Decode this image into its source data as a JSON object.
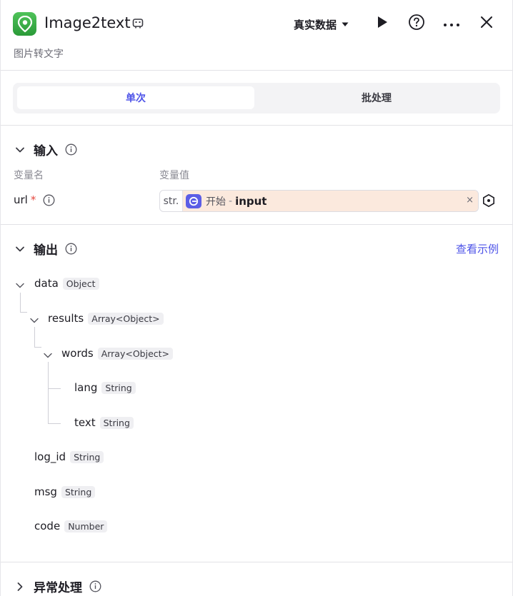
{
  "header": {
    "title": "Image2text",
    "subtitle": "图片转文字",
    "data_mode": "真实数据"
  },
  "tabs": [
    {
      "label": "单次",
      "active": true
    },
    {
      "label": "批处理",
      "active": false
    }
  ],
  "input_section": {
    "title": "输入",
    "col_name": "变量名",
    "col_value": "变量值",
    "param": {
      "name": "url",
      "required_mark": "*",
      "type_tag": "str.",
      "ref_node": "开始",
      "ref_sep": "-",
      "ref_var": "input",
      "clear": "×"
    }
  },
  "output_section": {
    "title": "输出",
    "example_link": "查看示例",
    "fields": [
      {
        "name": "data",
        "type": "Object"
      },
      {
        "name": "results",
        "type": "Array<Object>"
      },
      {
        "name": "words",
        "type": "Array<Object>"
      },
      {
        "name": "lang",
        "type": "String"
      },
      {
        "name": "text",
        "type": "String"
      },
      {
        "name": "log_id",
        "type": "String"
      },
      {
        "name": "msg",
        "type": "String"
      },
      {
        "name": "code",
        "type": "Number"
      }
    ]
  },
  "exception_section": {
    "title": "异常处理"
  },
  "icons": [
    "app-logo-icon",
    "edit-icon",
    "caret-down-icon",
    "play-icon",
    "help-icon",
    "more-icon",
    "close-icon",
    "chevron-down-icon",
    "chevron-right-icon",
    "info-icon",
    "start-node-icon",
    "variable-icon"
  ],
  "colors": {
    "accent": "#4d53e8",
    "ref_chip_bg": "#fbe9dd",
    "required": "#e5483f",
    "app_green": "#2a9a38"
  }
}
